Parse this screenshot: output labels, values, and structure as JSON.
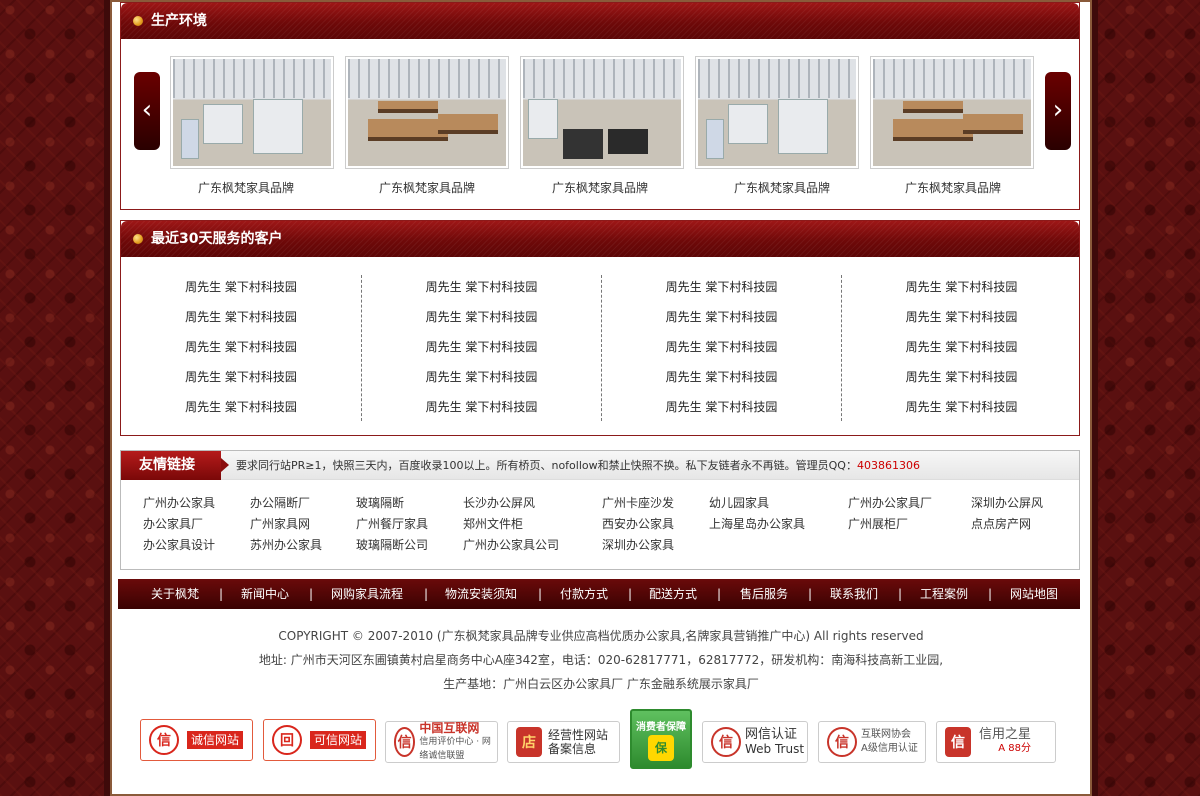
{
  "production": {
    "title": "生产环境",
    "prev_label": "‹",
    "next_label": "›",
    "items": [
      {
        "caption": "广东枫梵家具品牌"
      },
      {
        "caption": "广东枫梵家具品牌"
      },
      {
        "caption": "广东枫梵家具品牌"
      },
      {
        "caption": "广东枫梵家具品牌"
      },
      {
        "caption": "广东枫梵家具品牌"
      }
    ]
  },
  "clients": {
    "title": "最近30天服务的客户",
    "columns": [
      [
        "周先生  棠下村科技园",
        "周先生  棠下村科技园",
        "周先生  棠下村科技园",
        "周先生  棠下村科技园",
        "周先生  棠下村科技园"
      ],
      [
        "周先生  棠下村科技园",
        "周先生  棠下村科技园",
        "周先生  棠下村科技园",
        "周先生  棠下村科技园",
        "周先生  棠下村科技园"
      ],
      [
        "周先生  棠下村科技园",
        "周先生  棠下村科技园",
        "周先生  棠下村科技园",
        "周先生  棠下村科技园",
        "周先生  棠下村科技园"
      ],
      [
        "周先生  棠下村科技园",
        "周先生  棠下村科技园",
        "周先生  棠下村科技园",
        "周先生  棠下村科技园",
        "周先生  棠下村科技园"
      ]
    ]
  },
  "friend_links": {
    "title": "友情链接",
    "note": "要求同行站PR≥1，快照三天内，百度收录100以上。所有桥页、nofollow和禁止快照不换。私下友链者永不再链。管理员QQ：",
    "qq": "403861306",
    "rows": [
      [
        "广州办公家具",
        "办公隔断厂",
        "玻璃隔断",
        "长沙办公屏风",
        "广州卡座沙发",
        "幼儿园家具",
        "广州办公家具厂",
        "深圳办公屏风"
      ],
      [
        "办公家具厂",
        "广州家具网",
        "广州餐厅家具",
        "郑州文件柜",
        "西安办公家具",
        "上海星岛办公家具",
        "广州展柜厂",
        "点点房产网"
      ],
      [
        "办公家具设计",
        "苏州办公家具",
        "玻璃隔断公司",
        "广州办公家具公司",
        "深圳办公家具"
      ]
    ]
  },
  "nav": {
    "items": [
      "关于枫梵",
      "新闻中心",
      "网购家具流程",
      "物流安装须知",
      "付款方式",
      "配送方式",
      "售后服务",
      "联系我们",
      "工程案例",
      "网站地图"
    ],
    "separator": "|"
  },
  "footer": {
    "copyright": "COPYRIGHT © 2007-2010 (广东枫梵家具品牌专业供应高档优质办公家具,名牌家具营销推广中心) All rights reserved",
    "address": "地址: 广州市天河区东圃镇黄村启星商务中心A座342室，电话：020-62817771，62817772，研发机构：南海科技高新工业园,",
    "base": "生产基地：广州白云区办公家具厂 广东金融系统展示家具厂"
  },
  "badges": [
    {
      "icon": "信",
      "text": "诚信网站",
      "color": "#d9261c"
    },
    {
      "icon": "回",
      "text": "可信网站",
      "color": "#d9261c"
    },
    {
      "icon": "信",
      "text": "中国互联网",
      "sub": "信用评价中心 · 网络诚信联盟",
      "color": "#c8342a"
    },
    {
      "icon": "店",
      "text": "经营性网站",
      "sub": "备案信息",
      "color": "#c8342a"
    },
    {
      "icon": "保",
      "text": "消费者保障",
      "color": "#2e8b2e"
    },
    {
      "icon": "信",
      "text": "网信认证",
      "sub": "Web Trust",
      "color": "#c8342a"
    },
    {
      "icon": "信",
      "text": "互联网协会",
      "sub": "A级信用认证",
      "color": "#c8342a"
    },
    {
      "icon": "信",
      "text": "信用之星",
      "sub": "A  88分",
      "color": "#c8342a"
    }
  ]
}
